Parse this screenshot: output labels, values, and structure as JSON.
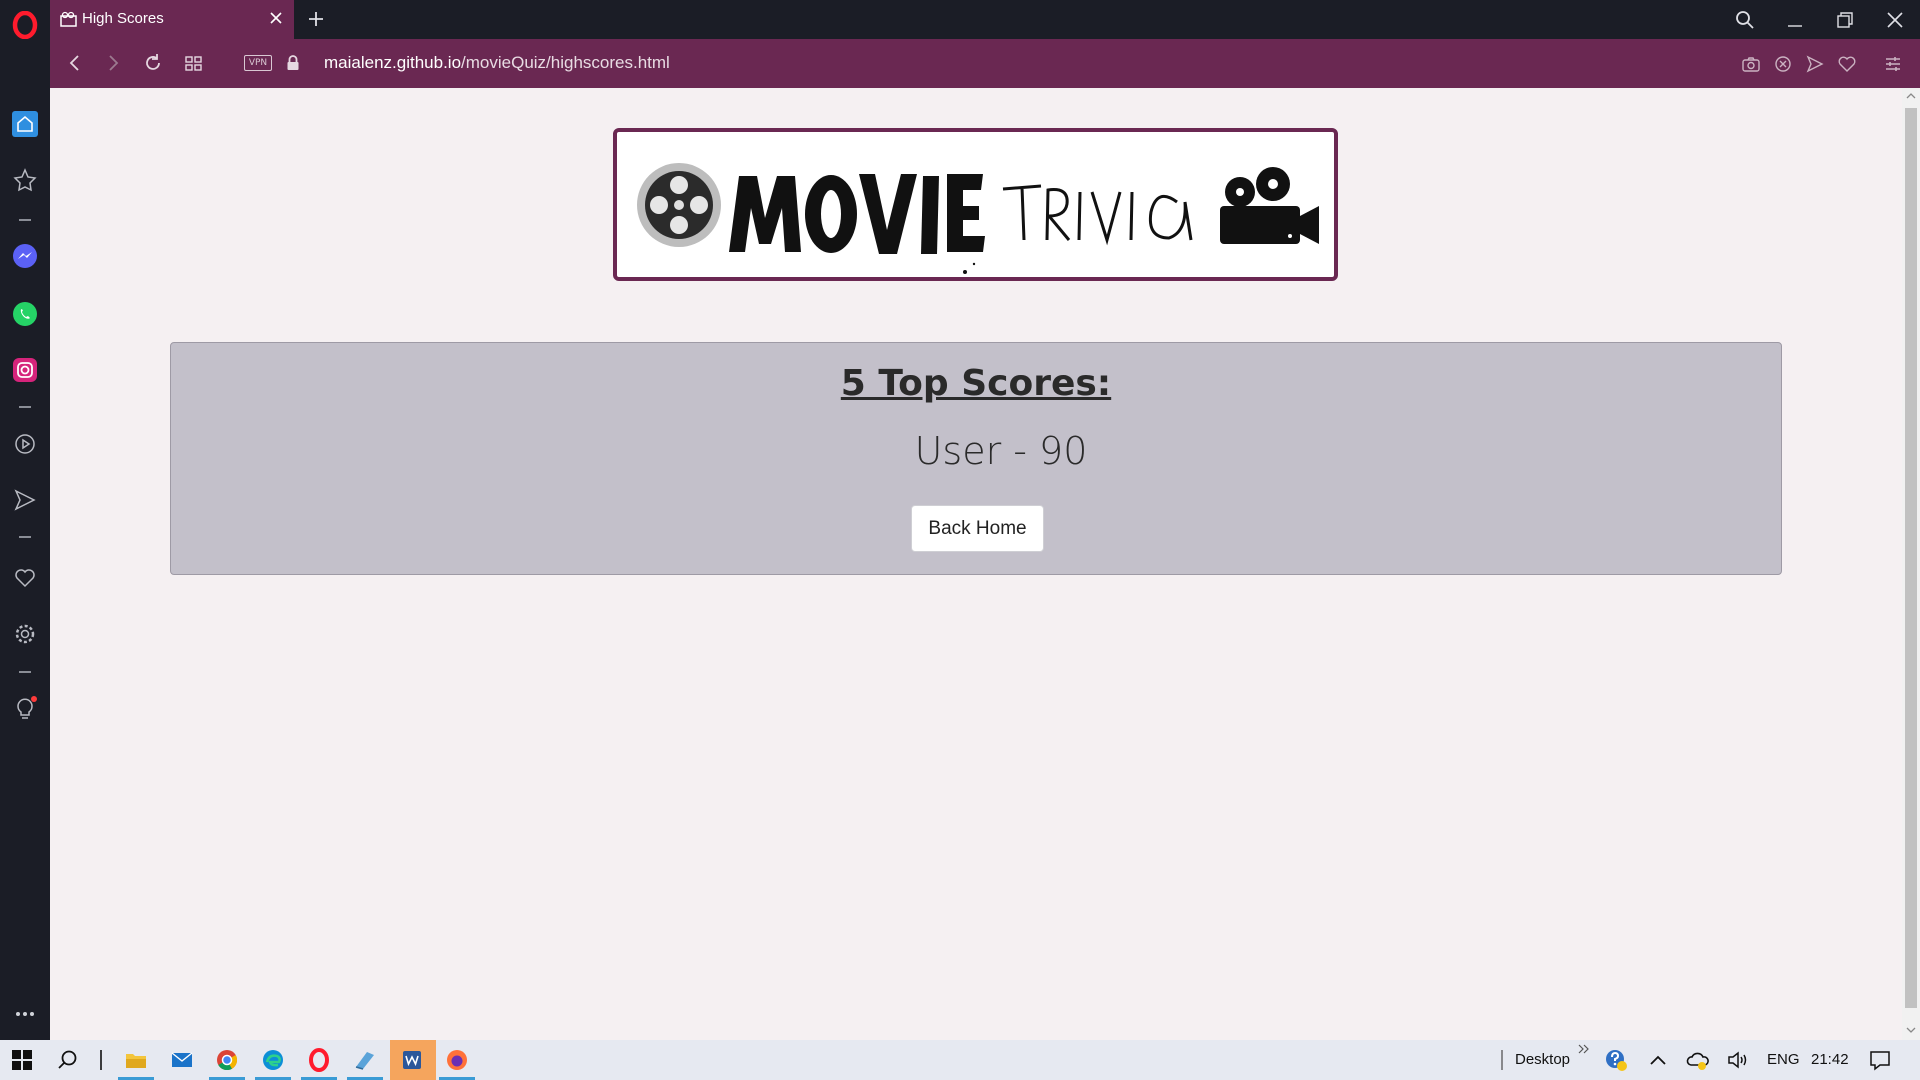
{
  "browser": {
    "tab_title": "High Scores",
    "url_host": "maialenz.github.io",
    "url_path": "/movieQuiz/highscores.html",
    "vpn_label": "VPN",
    "accent_color": "#6a2852"
  },
  "page": {
    "logo": {
      "word1": "MOVIE",
      "word2": "TRIVIA"
    },
    "scores_title": "5 Top Scores:",
    "scores": [
      "User - 90"
    ],
    "back_button": "Back Home"
  },
  "taskbar": {
    "desktop_label": "Desktop",
    "language": "ENG",
    "time": "21:42"
  }
}
